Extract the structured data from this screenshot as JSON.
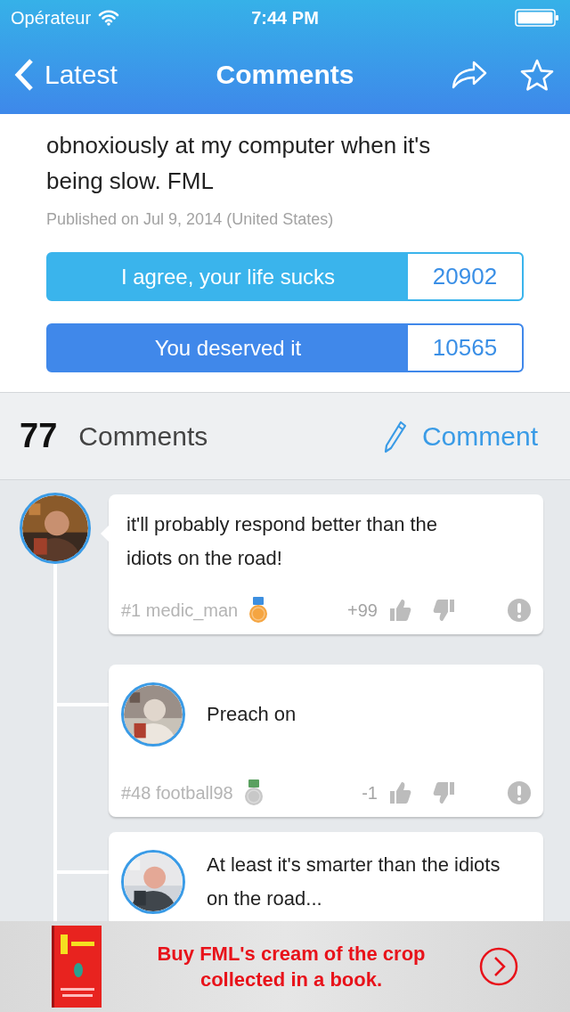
{
  "status_bar": {
    "carrier": "Opérateur",
    "time": "7:44 PM"
  },
  "nav": {
    "back": "Latest",
    "title": "Comments"
  },
  "post": {
    "text": "obnoxiously at my computer when it's being slow. FML",
    "published": "Published on Jul 9, 2014 (United States)",
    "votes": [
      {
        "kind": "agree",
        "label": "I agree, your life sucks",
        "count": "20902"
      },
      {
        "kind": "deserved",
        "label": "You deserved it",
        "count": "10565"
      }
    ]
  },
  "comments_header": {
    "count": "77",
    "label": "Comments",
    "action": "Comment"
  },
  "comments": [
    {
      "text": "it'll probably respond better than the idiots on the road!",
      "author": "#1 medic_man",
      "medal": {
        "kind": "gold"
      },
      "score": "+99",
      "children": [
        {
          "text": "Preach on",
          "author": "#48 football98",
          "medal": {
            "kind": "silver"
          },
          "score": "-1"
        },
        {
          "text": "At least it's smarter than the idiots on the road..."
        }
      ]
    }
  ],
  "ad": {
    "text": "Buy FML's cream of the crop collected in a book."
  }
}
